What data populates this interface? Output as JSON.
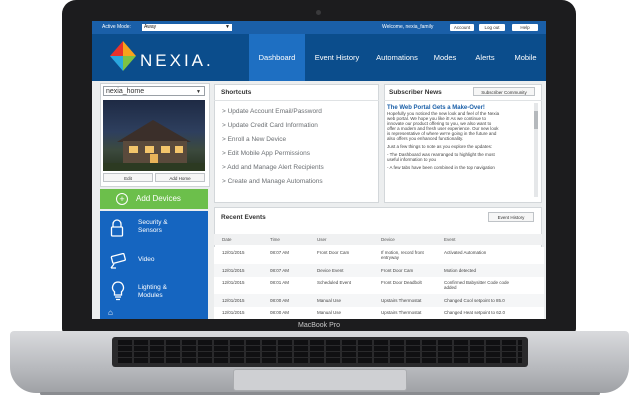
{
  "laptop": {
    "label": "MacBook Pro"
  },
  "topbar": {
    "active_mode_label": "Active Mode:",
    "active_mode_value": "Away",
    "welcome_text": "Welcome, nexia_family",
    "account_label": "Account",
    "logout_label": "Log out",
    "help_label": "Help"
  },
  "brand": {
    "logo_text": "NEXIA",
    "logo_suffix": "."
  },
  "nav": {
    "items": [
      {
        "label": "Dashboard",
        "active": true
      },
      {
        "label": "Event History"
      },
      {
        "label": "Automations"
      },
      {
        "label": "Modes"
      },
      {
        "label": "Alerts"
      },
      {
        "label": "Mobile"
      }
    ]
  },
  "home": {
    "selected": "nexia_home",
    "edit_label": "Edit",
    "add_home_label": "Add Home"
  },
  "add_devices_label": "Add Devices",
  "side_menu": {
    "items": [
      {
        "label_line1": "Security &",
        "label_line2": "Sensors",
        "icon": "lock-icon"
      },
      {
        "label_line1": "Video",
        "label_line2": "",
        "icon": "camera-icon"
      },
      {
        "label_line1": "Lighting &",
        "label_line2": "Modules",
        "icon": "lightbulb-icon"
      }
    ]
  },
  "shortcuts": {
    "title": "Shortcuts",
    "items": [
      "> Update Account Email/Password",
      "> Update Credit Card Information",
      "> Enroll a New Device",
      "> Edit Mobile App Permissions",
      "> Add and Manage Alert Recipients",
      "> Create and Manage Automations"
    ]
  },
  "news": {
    "title": "Subscriber News",
    "community_button": "Subscriber Community",
    "headline": "The Web Portal Gets a Make-Over!",
    "paragraph1_line1": "Hopefully you noticed the new look and feel of the Nexia",
    "paragraph1_line2": "web portal. We hope you like it! As we continue to",
    "paragraph1_line3": "innovate our product offering to you, we also want to",
    "paragraph1_line4": "offer a modern and fresh user experience. Our new look",
    "paragraph1_line5": "is representative of where we're going in the future and",
    "paragraph1_line6": "also offers you enhanced functionality.",
    "paragraph2": "Just a few things to note as you explore the updates:",
    "paragraph3_line1": "- The Dashboard was rearranged to highlight the most",
    "paragraph3_line2": "useful information to you",
    "paragraph4": "- A few tabs have been combined in the top navigation"
  },
  "events": {
    "title": "Recent Events",
    "history_button": "Event History",
    "columns": [
      "Date",
      "Time",
      "User",
      "Device",
      "Event"
    ],
    "rows": [
      [
        "12/01/2015",
        "08:07 AM",
        "Front Door Cam",
        "If motion, record front entryway",
        "Activated Automation"
      ],
      [
        "12/01/2015",
        "08:07 AM",
        "Device Event",
        "Front Door Cam",
        "Motion detected"
      ],
      [
        "12/01/2015",
        "08:01 AM",
        "Scheduled Event",
        "Front Door Deadbolt",
        "Confirmed Babysitter Code code added"
      ],
      [
        "12/01/2015",
        "08:00 AM",
        "Manual Use",
        "Upstairs Thermostat",
        "Changed Cool setpoint to 85.0"
      ],
      [
        "12/01/2015",
        "08:00 AM",
        "Manual Use",
        "Upstairs Thermostat",
        "Changed Heat setpoint to 62.0"
      ]
    ]
  },
  "colors": {
    "topbar": "#1a5fa8",
    "navbar": "#0b4d8c",
    "nav_active": "#1e6fc2",
    "add_devices": "#6cbf4b",
    "side_menu": "#1565c0"
  }
}
